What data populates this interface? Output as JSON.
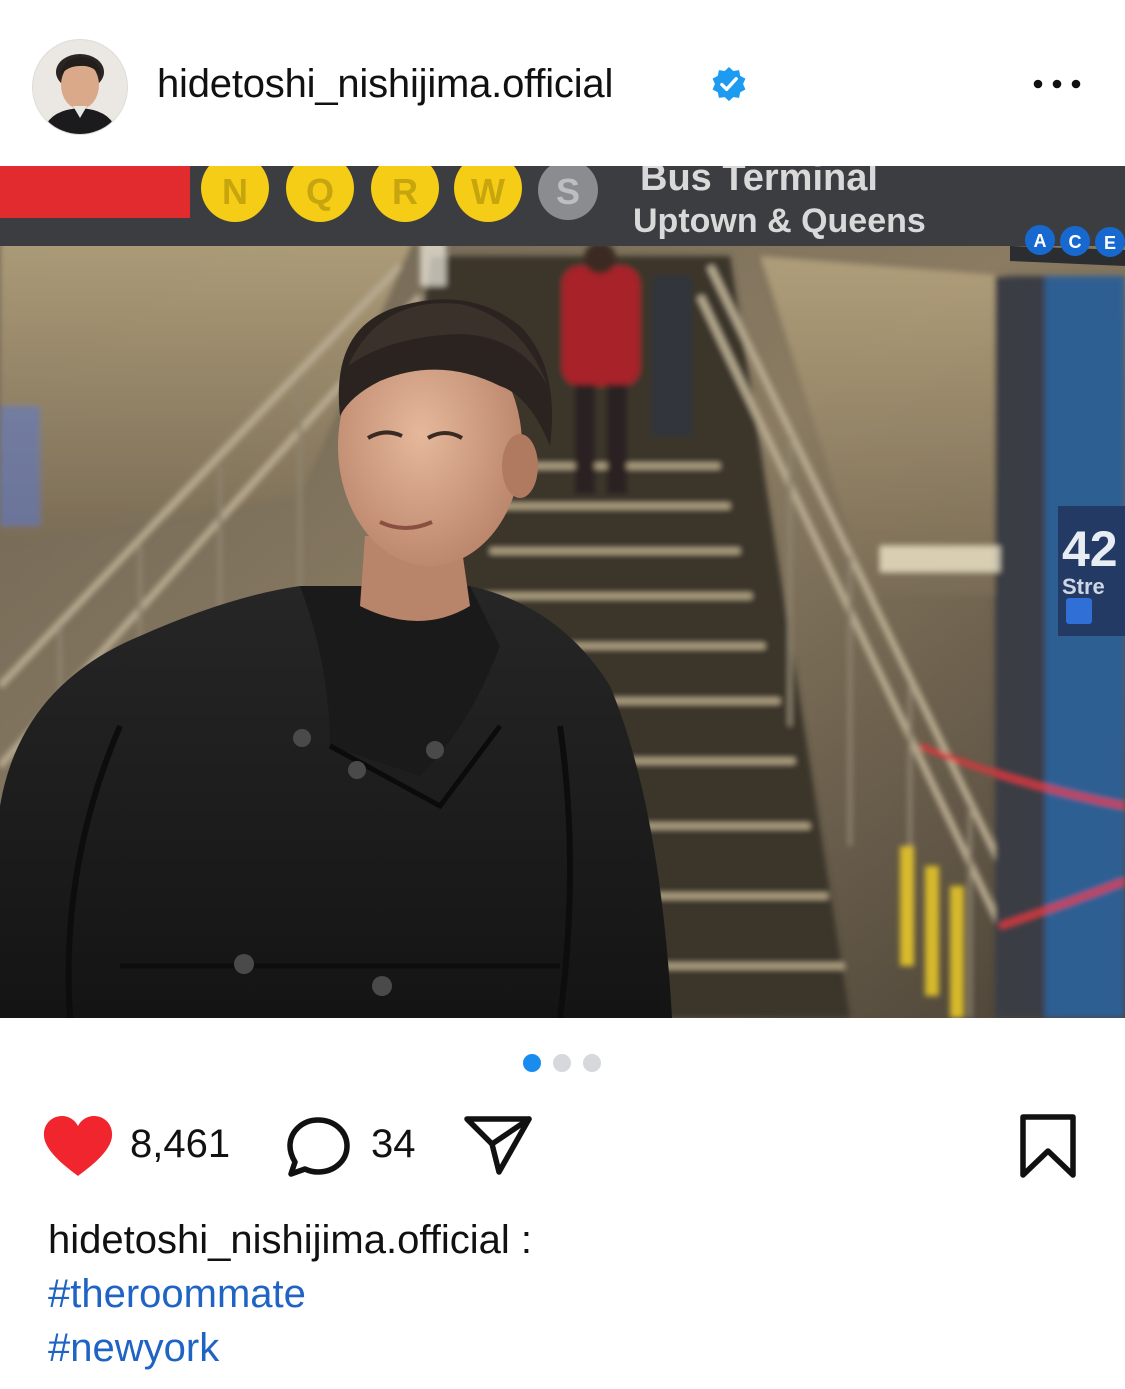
{
  "post": {
    "username": "hidetoshi_nishijima.official",
    "verified": true,
    "more_icon": "more-horizontal-icon"
  },
  "photo": {
    "signs": {
      "platform": "Bus Terminal",
      "direction": "Uptown & Queens",
      "lines_yellow": [
        "N",
        "Q",
        "R",
        "W"
      ],
      "line_shuttle": "S",
      "lines_blue": [
        "A",
        "C",
        "E"
      ],
      "street_number": "42",
      "street_word": "Stre"
    },
    "colors": {
      "sign_red": "#e12b2f",
      "line_yellow": "#f5cd16",
      "line_blue": "#1769d0"
    }
  },
  "carousel": {
    "count": 3,
    "active_index": 0,
    "active_color": "#1a8cf0"
  },
  "actions": {
    "likes": "8,461",
    "comments": "34",
    "like_icon": "heart-filled-icon",
    "like_color": "#f0252d",
    "comment_icon": "speech-bubble-icon",
    "share_icon": "paper-plane-icon",
    "save_icon": "bookmark-icon"
  },
  "caption": {
    "username": "hidetoshi_nishijima.official",
    "separator": " :",
    "hashtags": [
      "#theroommate",
      "#newyork"
    ],
    "hashtag_color": "#1f64c4"
  }
}
